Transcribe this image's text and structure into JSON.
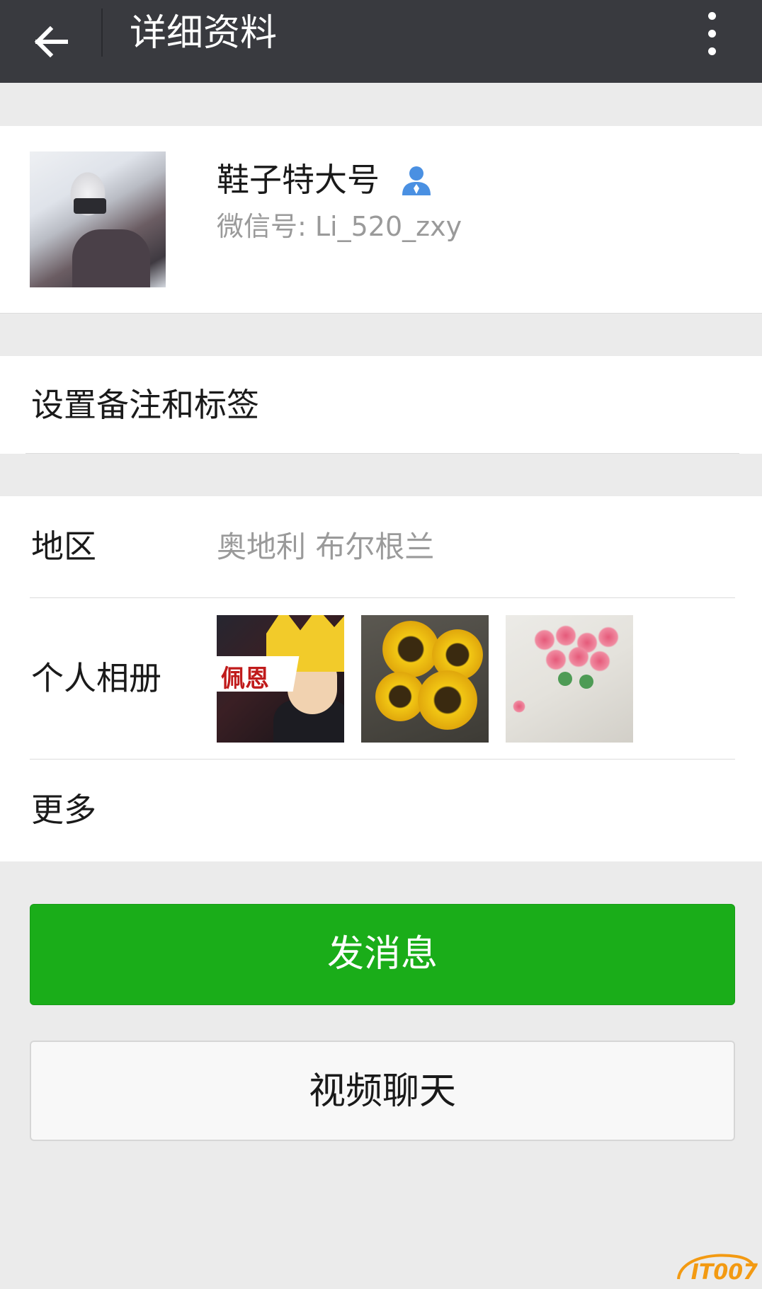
{
  "header": {
    "title": "详细资料",
    "back_icon": "arrow-left-icon",
    "more_icon": "more-vertical-icon",
    "background": "#393a3f"
  },
  "profile": {
    "nickname": "鞋子特大号",
    "wechat_id": "微信号: Li_520_zxy",
    "contact_badge_icon": "person-icon",
    "badge_color": "#4a90e2"
  },
  "remark": {
    "label": "设置备注和标签"
  },
  "info": {
    "region_label": "地区",
    "region_value": "奥地利  布尔根兰",
    "album_label": "个人相册",
    "album_thumbs": [
      "album-photo-anime",
      "album-photo-sunflowers",
      "album-photo-roses"
    ],
    "album_thumb_1_text": "佩恩",
    "more_label": "更多"
  },
  "actions": {
    "send_message": "发消息",
    "video_chat": "视频聊天",
    "send_color": "#1aad19"
  },
  "watermark": {
    "text": "IT007"
  }
}
